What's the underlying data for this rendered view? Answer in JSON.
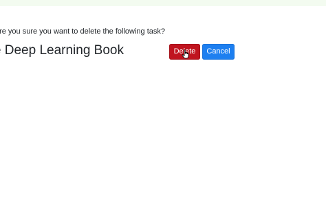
{
  "prompt": {
    "question": "Are you sure you want to delete the following task?"
  },
  "task": {
    "title": "The Deep Learning Book"
  },
  "actions": {
    "delete_label": "Delete",
    "cancel_label": "Cancel"
  },
  "colors": {
    "delete": "#c0141f",
    "cancel": "#1d7ff0",
    "top_band": "#f3fbf0"
  },
  "cursor": {
    "icon": "hand-pointer-icon"
  }
}
